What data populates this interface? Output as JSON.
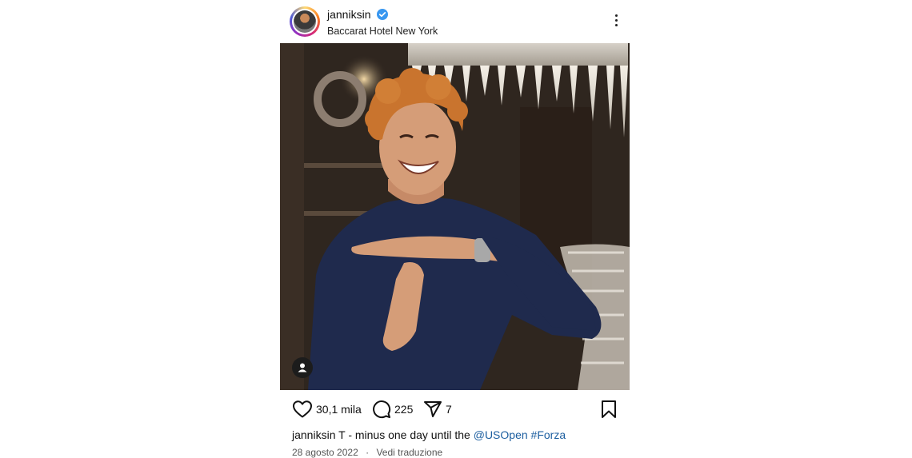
{
  "post": {
    "username": "janniksin",
    "verified": true,
    "location": "Baccarat Hotel New York",
    "likes": "30,1 mila",
    "comments": "225",
    "shares": "7",
    "caption": {
      "username": "janniksin",
      "text": "T - minus one day until the",
      "mention": "@USOpen",
      "hashtag": "#Forza"
    },
    "date": "28 agosto 2022",
    "separator": "·",
    "translate_label": "Vedi traduzione"
  },
  "colors": {
    "link": "#1d5fa0",
    "verified": "#3897f0"
  },
  "icons": [
    "more-options-icon",
    "verified-icon",
    "like-icon",
    "comment-icon",
    "share-icon",
    "save-icon",
    "user-tag-icon"
  ]
}
